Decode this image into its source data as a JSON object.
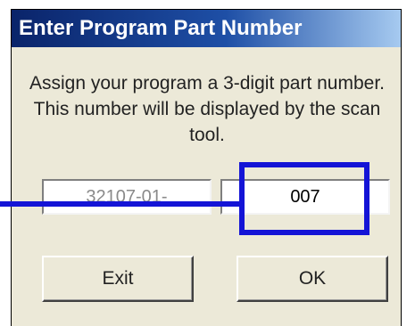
{
  "dialog": {
    "title": "Enter Program Part Number",
    "message": "Assign your program a 3-digit part number.  This number will be displayed by the scan tool.",
    "prefix_value": "32107-01-",
    "part_number_value": "007",
    "exit_label": "Exit",
    "ok_label": "OK"
  },
  "annotation": {
    "color": "#1414d6"
  },
  "colors": {
    "titlebar_start": "#0a246a",
    "titlebar_end": "#a6caf0",
    "dialog_bg": "#ece9d8"
  }
}
